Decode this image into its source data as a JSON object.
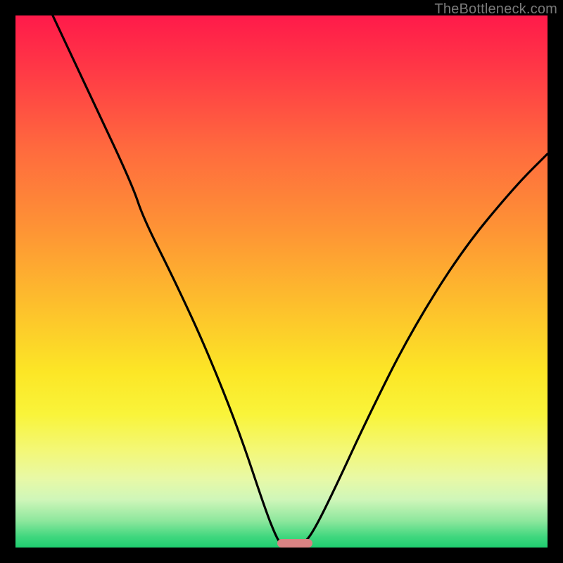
{
  "watermark": "TheBottleneck.com",
  "colors": {
    "frame": "#000000",
    "curve": "#000000",
    "marker": "#D98383",
    "gradient_stops": [
      {
        "pos": 0.0,
        "hex": "#FF1A4A"
      },
      {
        "pos": 0.1,
        "hex": "#FF3846"
      },
      {
        "pos": 0.25,
        "hex": "#FF6A3E"
      },
      {
        "pos": 0.4,
        "hex": "#FE9335"
      },
      {
        "pos": 0.55,
        "hex": "#FDC12C"
      },
      {
        "pos": 0.67,
        "hex": "#FCE626"
      },
      {
        "pos": 0.75,
        "hex": "#F9F43A"
      },
      {
        "pos": 0.82,
        "hex": "#F3F879"
      },
      {
        "pos": 0.87,
        "hex": "#E8F9A6"
      },
      {
        "pos": 0.91,
        "hex": "#CFF6B9"
      },
      {
        "pos": 0.95,
        "hex": "#8DE79D"
      },
      {
        "pos": 0.98,
        "hex": "#3FD77E"
      },
      {
        "pos": 1.0,
        "hex": "#1FCE70"
      }
    ]
  },
  "chart_data": {
    "type": "line",
    "title": "",
    "xlabel": "",
    "ylabel": "",
    "xlim": [
      0,
      100
    ],
    "ylim": [
      0,
      100
    ],
    "note": "bottleneck-style curve: two branches descending to a flat minimum near x≈52",
    "curve_points_xy": [
      [
        7,
        100
      ],
      [
        15,
        83
      ],
      [
        22,
        68
      ],
      [
        24,
        62
      ],
      [
        30,
        50
      ],
      [
        36,
        37
      ],
      [
        42,
        22
      ],
      [
        47,
        7
      ],
      [
        49,
        2
      ],
      [
        50,
        0.5
      ],
      [
        52,
        0.5
      ],
      [
        54,
        0.5
      ],
      [
        56,
        3
      ],
      [
        60,
        11
      ],
      [
        66,
        24
      ],
      [
        74,
        40
      ],
      [
        84,
        56
      ],
      [
        94,
        68
      ],
      [
        100,
        74
      ]
    ],
    "flat_min_segment_x": [
      50,
      55
    ],
    "marker_x_center": 52
  }
}
